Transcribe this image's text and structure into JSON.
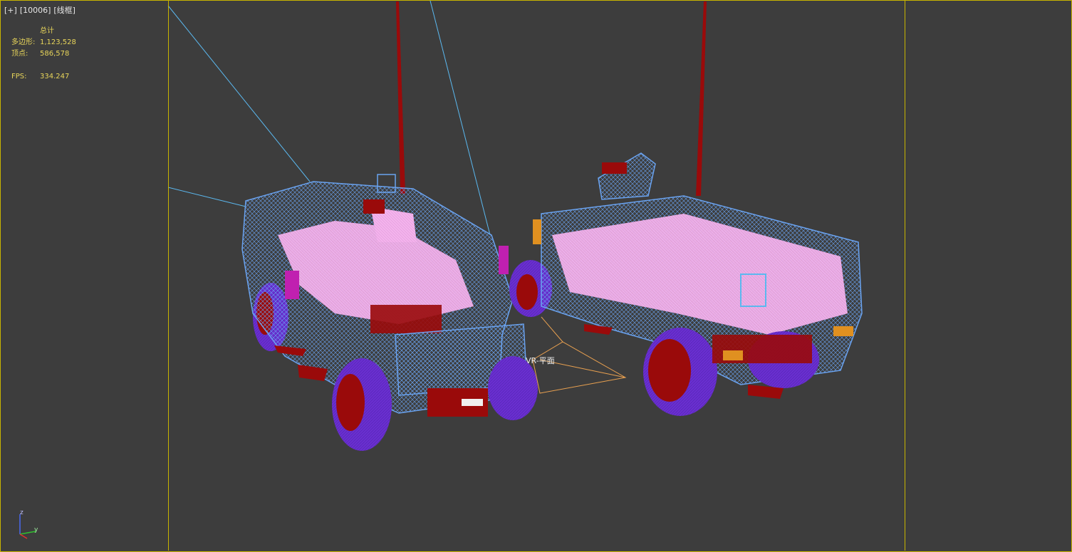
{
  "viewport": {
    "labels": [
      "[+]",
      "[10006]",
      "[线框]"
    ]
  },
  "stats": {
    "header": "总计",
    "polygons_label": "多边形:",
    "polygons_value": "1,123,528",
    "vertices_label": "顶点:",
    "vertices_value": "586,578",
    "fps_label": "FPS:",
    "fps_value": "334.247"
  },
  "scene": {
    "light_label": "VR-平面",
    "objects": [
      "armored-vehicle-front-view",
      "armored-vehicle-side-view"
    ],
    "wireframe_colors": {
      "body": "#6aa3f0",
      "seats": "#f0a8e8",
      "tires": "#6a2fd0",
      "red_parts": "#9a0a0a",
      "camera_lines": "#5bb8ef",
      "light_lines": "#e8a050"
    }
  },
  "axis_gizmo": {
    "z": "z",
    "y": "y"
  },
  "colors": {
    "background": "#3d3d3d",
    "frame": "#c8b400",
    "stats_text": "#e8d55a"
  }
}
